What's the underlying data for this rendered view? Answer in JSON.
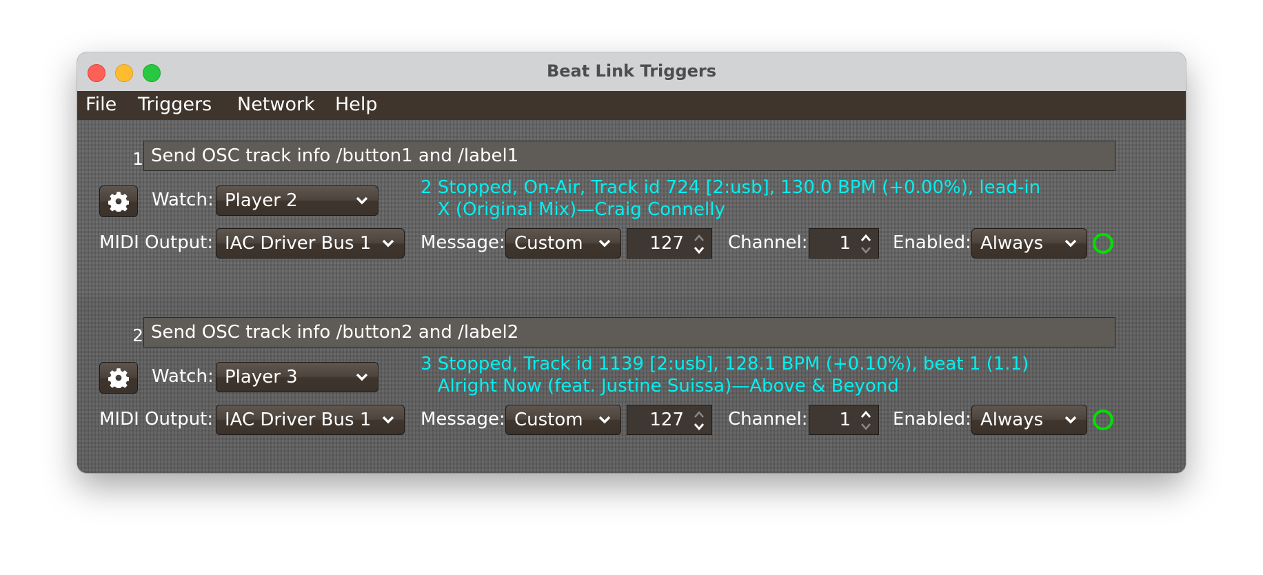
{
  "window": {
    "title": "Beat Link Triggers"
  },
  "menubar": {
    "items": [
      "File",
      "Triggers",
      "Network",
      "Help"
    ]
  },
  "labels": {
    "watch": "Watch:",
    "midi_output": "MIDI Output:",
    "message": "Message:",
    "channel": "Channel:",
    "enabled": "Enabled:"
  },
  "triggers": [
    {
      "index": "1.",
      "comment": "Send OSC track info /button1 and /label1",
      "watch": "Player 2",
      "status_line1": "2 Stopped, On-Air, Track id 724 [2:usb], 130.0 BPM (+0.00%), lead-in",
      "status_line2": "X (Original Mix)—Craig Connelly",
      "midi_output": "IAC Driver Bus 1",
      "message": "Custom",
      "note": "127",
      "channel": "1",
      "enabled": "Always",
      "indicator_color": "#00e000"
    },
    {
      "index": "2.",
      "comment": "Send OSC track info /button2 and /label2",
      "watch": "Player 3",
      "status_line1": "3 Stopped, Track id 1139 [2:usb], 128.1 BPM (+0.10%), beat 1 (1.1)",
      "status_line2": "Alright Now (feat. Justine Suissa)—Above & Beyond",
      "midi_output": "IAC Driver Bus 1",
      "message": "Custom",
      "note": "127",
      "channel": "1",
      "enabled": "Always",
      "indicator_color": "#00e000"
    }
  ],
  "colors": {
    "status_text": "#00f0f0",
    "menubar_bg": "#3f352d",
    "indicator": "#00e000"
  }
}
